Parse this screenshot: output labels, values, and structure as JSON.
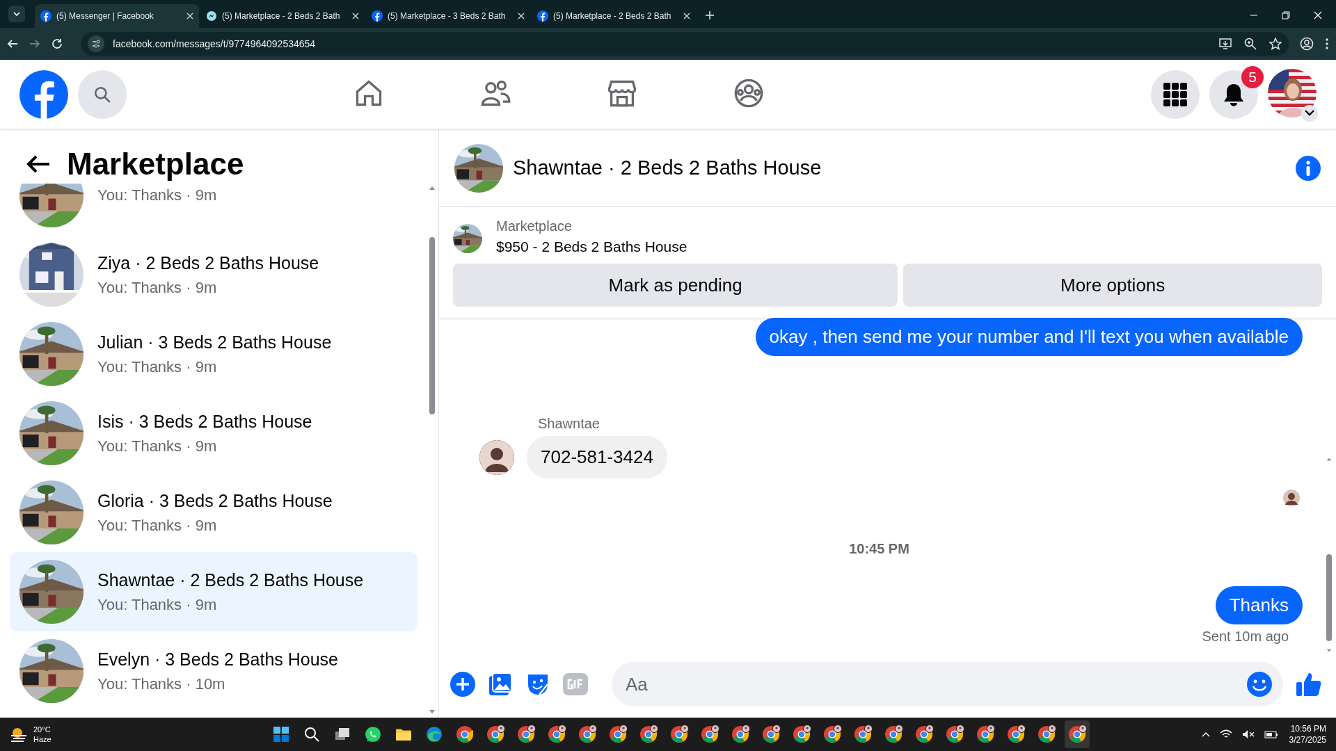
{
  "browser": {
    "tabs": [
      {
        "title": "(5) Messenger | Facebook",
        "kind": "facebook",
        "selected": true
      },
      {
        "title": "(5) Marketplace - 2 Beds 2 Bath",
        "kind": "messenger",
        "selected": false
      },
      {
        "title": "(5) Marketplace - 3 Beds 2 Bath",
        "kind": "facebook",
        "selected": false
      },
      {
        "title": "(5) Marketplace - 2 Beds 2 Bath",
        "kind": "facebook",
        "selected": false
      }
    ],
    "address": "facebook.com/messages/t/9774964092534654"
  },
  "header": {
    "nav": [
      {
        "kind": "home",
        "selected": false
      },
      {
        "kind": "friends",
        "selected": false
      },
      {
        "kind": "marketplace",
        "selected": false
      },
      {
        "kind": "groups",
        "selected": false
      }
    ],
    "notification_count": "5"
  },
  "sidebar": {
    "title": "Marketplace",
    "conversations": [
      {
        "snippet": "You: Thanks · 9m",
        "selected": false
      },
      {
        "name": "Ziya · 2 Beds 2 Baths House",
        "snippet": "You: Thanks · 9m",
        "selected": false
      },
      {
        "name": "Julian · 3 Beds 2 Baths House",
        "snippet": "You: Thanks · 9m",
        "selected": false
      },
      {
        "name": "Isis · 3 Beds 2 Baths House",
        "snippet": "You: Thanks · 9m",
        "selected": false
      },
      {
        "name": "Gloria · 3 Beds 2 Baths House",
        "snippet": "You: Thanks · 9m",
        "selected": false
      },
      {
        "name": "Shawntae · 2 Beds 2 Baths House",
        "snippet": "You: Thanks · 9m",
        "selected": true
      },
      {
        "name": "Evelyn · 3 Beds 2 Baths House",
        "snippet": "You: Thanks · 10m",
        "selected": false
      }
    ]
  },
  "chat": {
    "title": "Shawntae · 2 Beds 2 Baths House",
    "listing": {
      "source": "Marketplace",
      "price_title": "$950 - 2 Beds 2 Baths House",
      "buttons": [
        "Mark as pending",
        "More options"
      ]
    },
    "messages": [
      {
        "kind": "outgoing",
        "text": "okay , then send me your number and I'll text you when available"
      },
      {
        "kind": "sender",
        "text": "Shawntae"
      },
      {
        "kind": "incoming",
        "text": "702-581-3424"
      },
      {
        "kind": "seen"
      },
      {
        "kind": "timestamp",
        "text": "10:45 PM"
      },
      {
        "kind": "outgoing",
        "text": "Thanks"
      },
      {
        "kind": "status",
        "text": "Sent 10m ago"
      }
    ],
    "composer": {
      "placeholder": "Aa"
    }
  },
  "taskbar": {
    "weather": {
      "temperature": "20°C",
      "condition": "Haze"
    },
    "apps": [
      {
        "kind": "start",
        "selected": false
      },
      {
        "kind": "search",
        "selected": false
      },
      {
        "kind": "taskview",
        "selected": false
      },
      {
        "kind": "whatsapp",
        "selected": false
      },
      {
        "kind": "explorer",
        "selected": false
      },
      {
        "kind": "edge",
        "selected": false
      },
      {
        "kind": "chrome",
        "selected": false
      },
      {
        "kind": "profile",
        "selected": false
      },
      {
        "kind": "profile",
        "selected": false
      },
      {
        "kind": "profile",
        "selected": false
      },
      {
        "kind": "profile",
        "selected": false
      },
      {
        "kind": "profile",
        "selected": false
      },
      {
        "kind": "profile",
        "selected": false
      },
      {
        "kind": "profile",
        "selected": false
      },
      {
        "kind": "profile",
        "selected": false
      },
      {
        "kind": "profile",
        "selected": false
      },
      {
        "kind": "profile",
        "selected": false
      },
      {
        "kind": "profile",
        "selected": false
      },
      {
        "kind": "profile",
        "selected": false
      },
      {
        "kind": "profile",
        "selected": false
      },
      {
        "kind": "profile",
        "selected": false
      },
      {
        "kind": "profile",
        "selected": false
      },
      {
        "kind": "profile",
        "selected": false
      },
      {
        "kind": "profile",
        "selected": false
      },
      {
        "kind": "profile",
        "selected": false
      },
      {
        "kind": "profile",
        "selected": false
      },
      {
        "kind": "profile",
        "selected": true
      }
    ],
    "time": "10:56 PM",
    "date": "3/27/2025"
  }
}
